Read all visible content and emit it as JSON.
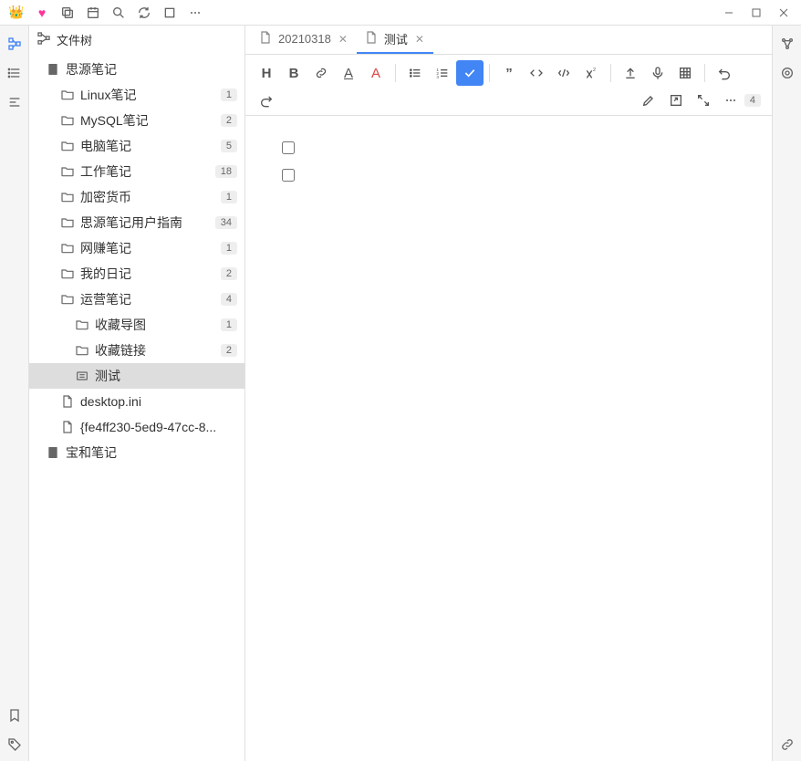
{
  "titlebar": {
    "icons": [
      "crown",
      "heart",
      "copy",
      "calendar",
      "search",
      "sync",
      "window",
      "more"
    ]
  },
  "leftbar": {
    "top": [
      "file-tree",
      "outline",
      "align-left"
    ],
    "bottom": [
      "bookmark",
      "tag"
    ]
  },
  "sidebar": {
    "title": "文件树",
    "tree": [
      {
        "depth": 0,
        "icon": "notebook",
        "label": "思源笔记",
        "count": null
      },
      {
        "depth": 1,
        "icon": "folder",
        "label": "Linux笔记",
        "count": "1"
      },
      {
        "depth": 1,
        "icon": "folder",
        "label": "MySQL笔记",
        "count": "2"
      },
      {
        "depth": 1,
        "icon": "folder",
        "label": "电脑笔记",
        "count": "5"
      },
      {
        "depth": 1,
        "icon": "folder",
        "label": "工作笔记",
        "count": "18"
      },
      {
        "depth": 1,
        "icon": "folder",
        "label": "加密货币",
        "count": "1"
      },
      {
        "depth": 1,
        "icon": "folder",
        "label": "思源笔记用户指南",
        "count": "34"
      },
      {
        "depth": 1,
        "icon": "folder",
        "label": "网赚笔记",
        "count": "1"
      },
      {
        "depth": 1,
        "icon": "folder",
        "label": "我的日记",
        "count": "2"
      },
      {
        "depth": 1,
        "icon": "folder",
        "label": "运营笔记",
        "count": "4"
      },
      {
        "depth": 2,
        "icon": "folder",
        "label": "收藏导图",
        "count": "1"
      },
      {
        "depth": 2,
        "icon": "folder",
        "label": "收藏链接",
        "count": "2"
      },
      {
        "depth": 2,
        "icon": "doc",
        "label": "测试",
        "count": null,
        "selected": true
      },
      {
        "depth": 1,
        "icon": "file",
        "label": "desktop.ini",
        "count": null
      },
      {
        "depth": 1,
        "icon": "file",
        "label": "{fe4ff230-5ed9-47cc-8...",
        "count": null
      },
      {
        "depth": 0,
        "icon": "notebook",
        "label": "宝和笔记",
        "count": null
      }
    ]
  },
  "tabs": [
    {
      "label": "20210318",
      "active": false
    },
    {
      "label": "测试",
      "active": true
    }
  ],
  "toolbar": {
    "row1_groups": [
      [
        "heading",
        "bold",
        "link",
        "format",
        "font-color"
      ],
      [
        "list-ul",
        "list-ol",
        "check"
      ],
      [
        "quote",
        "code",
        "code-block",
        "superscript"
      ],
      [
        "upload",
        "mic",
        "table"
      ],
      [
        "undo"
      ]
    ],
    "active_tool": "check",
    "row2_tools": [
      "redo"
    ],
    "row2_right": [
      "edit",
      "open",
      "fullscreen",
      "more"
    ],
    "word_count": "4"
  },
  "editor": {
    "tasks": [
      {
        "checked": false
      },
      {
        "checked": false
      }
    ]
  },
  "rightbar": {
    "top": [
      "graph",
      "settings"
    ],
    "bottom": [
      "link"
    ]
  }
}
